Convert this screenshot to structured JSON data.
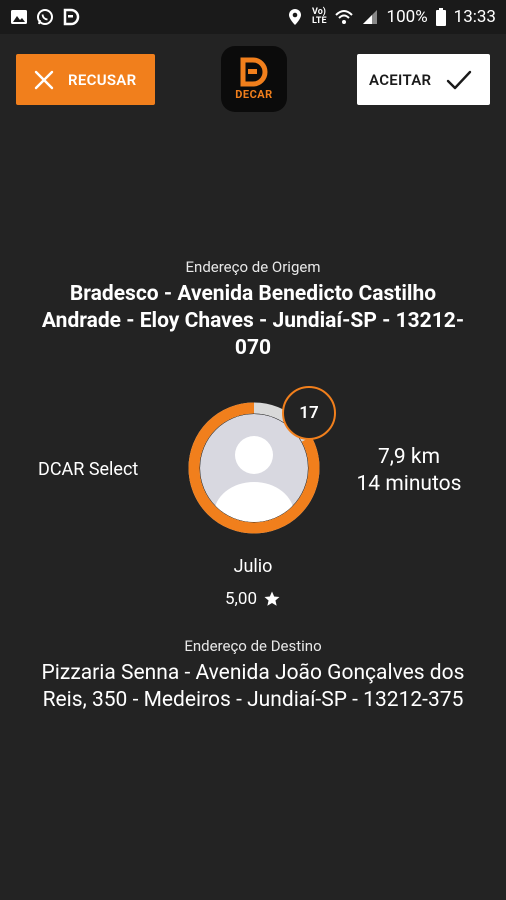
{
  "status_bar": {
    "battery": "100%",
    "time": "13:33",
    "network_label": "Vo) LTE",
    "icons": [
      "image-icon",
      "whatsapp-icon",
      "dcar-icon",
      "location-icon",
      "volte-icon",
      "wifi-icon",
      "signal-icon",
      "battery-icon"
    ]
  },
  "topbar": {
    "refuse_label": "RECUSAR",
    "accept_label": "ACEITAR",
    "logo_text": "DECAR",
    "logo_letter": "D",
    "accent_color": "#f17f1c"
  },
  "origin": {
    "label": "Endereço de Origem",
    "address": "Bradesco - Avenida Benedicto Castilho Andrade - Eloy Chaves - Jundiaí-SP - 13212-070"
  },
  "driver": {
    "service": "DCAR Select",
    "badge_count": "17",
    "distance": "7,9 km",
    "duration": "14 minutos",
    "name": "Julio",
    "rating": "5,00",
    "timer_progress": 0.83
  },
  "destination": {
    "label": "Endereço de Destino",
    "address": "Pizzaria Senna - Avenida João Gonçalves dos Reis, 350 - Medeiros - Jundiaí-SP - 13212-375"
  }
}
